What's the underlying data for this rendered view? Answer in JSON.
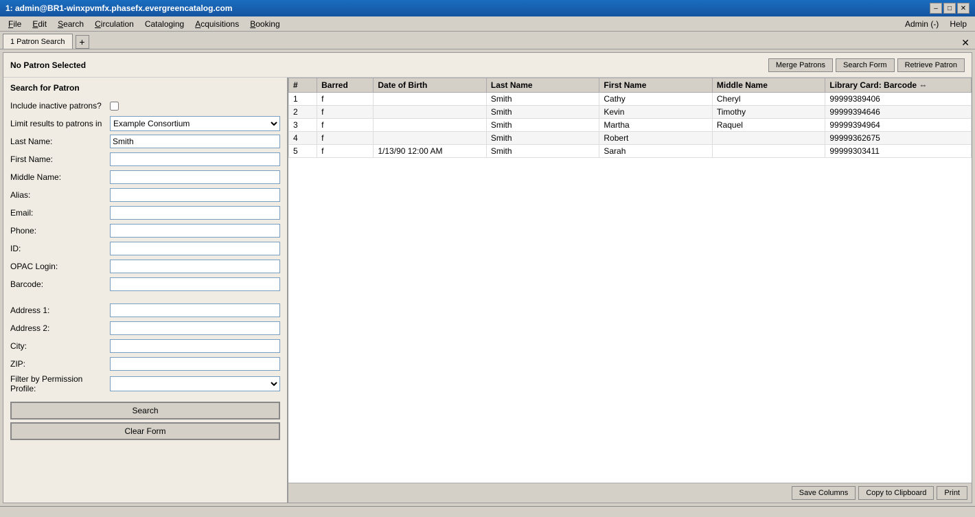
{
  "titlebar": {
    "title": "1: admin@BR1-winxpvmfx.phasefx.evergreencatalog.com",
    "min_label": "–",
    "max_label": "□",
    "close_label": "✕"
  },
  "menubar": {
    "items": [
      {
        "label": "File",
        "id": "file"
      },
      {
        "label": "Edit",
        "id": "edit"
      },
      {
        "label": "Search",
        "id": "search"
      },
      {
        "label": "Circulation",
        "id": "circulation"
      },
      {
        "label": "Cataloging",
        "id": "cataloging"
      },
      {
        "label": "Acquisitions",
        "id": "acquisitions"
      },
      {
        "label": "Booking",
        "id": "booking"
      }
    ],
    "admin_label": "Admin (-)",
    "help_label": "Help"
  },
  "tabs": [
    {
      "label": "1 Patron Search",
      "active": true
    },
    {
      "label": "+",
      "is_add": true
    }
  ],
  "header": {
    "no_patron": "No Patron Selected",
    "merge_btn": "Merge Patrons",
    "search_form_btn": "Search Form",
    "retrieve_btn": "Retrieve Patron"
  },
  "search_form": {
    "title": "Search for Patron",
    "include_inactive_label": "Include inactive patrons?",
    "limit_results_label": "Limit results to patrons in",
    "limit_results_options": [
      "Example Consortium"
    ],
    "limit_results_value": "Example Consortium",
    "fields": [
      {
        "label": "Last Name:",
        "id": "last-name",
        "value": "Smith"
      },
      {
        "label": "First Name:",
        "id": "first-name",
        "value": ""
      },
      {
        "label": "Middle Name:",
        "id": "middle-name",
        "value": ""
      },
      {
        "label": "Alias:",
        "id": "alias",
        "value": ""
      },
      {
        "label": "Email:",
        "id": "email",
        "value": ""
      },
      {
        "label": "Phone:",
        "id": "phone",
        "value": ""
      },
      {
        "label": "ID:",
        "id": "id",
        "value": ""
      },
      {
        "label": "OPAC Login:",
        "id": "opac-login",
        "value": ""
      },
      {
        "label": "Barcode:",
        "id": "barcode",
        "value": ""
      }
    ],
    "address_fields": [
      {
        "label": "Address 1:",
        "id": "address1",
        "value": ""
      },
      {
        "label": "Address 2:",
        "id": "address2",
        "value": ""
      },
      {
        "label": "City:",
        "id": "city",
        "value": ""
      },
      {
        "label": "ZIP:",
        "id": "zip",
        "value": ""
      }
    ],
    "permission_label": "Filter by Permission Profile:",
    "permission_options": [
      ""
    ],
    "search_btn": "Search",
    "clear_btn": "Clear Form"
  },
  "results": {
    "columns": [
      {
        "label": "#",
        "id": "num"
      },
      {
        "label": "Barred",
        "id": "barred"
      },
      {
        "label": "Date of Birth",
        "id": "dob"
      },
      {
        "label": "Last Name",
        "id": "last"
      },
      {
        "label": "First Name",
        "id": "first"
      },
      {
        "label": "Middle Name",
        "id": "middle"
      },
      {
        "label": "Library Card: Barcode",
        "id": "libcard"
      }
    ],
    "rows": [
      {
        "num": "1",
        "barred": "f",
        "dob": "",
        "last": "Smith",
        "first": "Cathy",
        "middle": "Cheryl",
        "libcard": "99999389406"
      },
      {
        "num": "2",
        "barred": "f",
        "dob": "",
        "last": "Smith",
        "first": "Kevin",
        "middle": "Timothy",
        "libcard": "99999394646"
      },
      {
        "num": "3",
        "barred": "f",
        "dob": "",
        "last": "Smith",
        "first": "Martha",
        "middle": "Raquel",
        "libcard": "99999394964"
      },
      {
        "num": "4",
        "barred": "f",
        "dob": "",
        "last": "Smith",
        "first": "Robert",
        "middle": "",
        "libcard": "99999362675"
      },
      {
        "num": "5",
        "barred": "f",
        "dob": "1/13/90 12:00 AM",
        "last": "Smith",
        "first": "Sarah",
        "middle": "",
        "libcard": "99999303411"
      }
    ],
    "save_columns_btn": "Save Columns",
    "copy_clipboard_btn": "Copy to Clipboard",
    "print_btn": "Print"
  }
}
